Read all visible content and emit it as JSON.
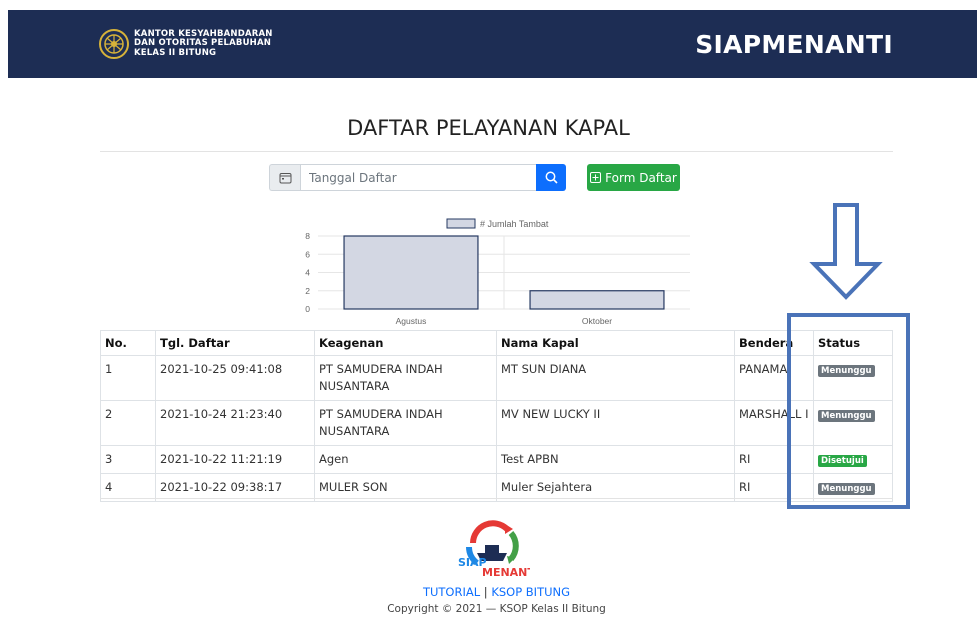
{
  "header": {
    "org_line1": "KANTOR KESYAHBANDARAN",
    "org_line2": "DAN OTORITAS PELABUHAN",
    "org_line3": "KELAS II BITUNG",
    "app_title": "SIAPMENANTI"
  },
  "page": {
    "title": "DAFTAR PELAYANAN KAPAL"
  },
  "search": {
    "placeholder": "Tanggal Daftar",
    "value": ""
  },
  "form_button": {
    "label": "Form Daftar"
  },
  "colors": {
    "navbar": "#1d2d54",
    "primary": "#0d6efd",
    "success": "#28a745",
    "secondary": "#6c757d",
    "bar_fill": "#d3d7e3",
    "bar_stroke": "#253861",
    "annotation": "#4a73b8"
  },
  "icons": [
    "calendar-icon",
    "search-icon",
    "plus-square-icon",
    "down-arrow-icon",
    "ship-logo"
  ],
  "chart_data": {
    "type": "bar",
    "categories": [
      "Agustus",
      "Oktober"
    ],
    "series": [
      {
        "name": "# Jumlah Tambat",
        "values": [
          8,
          2
        ]
      }
    ],
    "ylim": [
      0,
      8
    ],
    "yticks": [
      0,
      2,
      4,
      6,
      8
    ],
    "legend": "top",
    "grid": true
  },
  "table": {
    "columns": [
      "No.",
      "Tgl. Daftar",
      "Keagenan",
      "Nama Kapal",
      "Bendera",
      "Status"
    ],
    "rows": [
      {
        "no": "1",
        "date": "2021-10-25 09:41:08",
        "agency": "PT SAMUDERA INDAH NUSANTARA",
        "ship": "MT SUN DIANA",
        "flag": "PANAMA",
        "status": "Menunggu"
      },
      {
        "no": "2",
        "date": "2021-10-24 21:23:40",
        "agency": "PT SAMUDERA INDAH NUSANTARA",
        "ship": "MV NEW LUCKY II",
        "flag": "MARSHALL I",
        "status": "Menunggu"
      },
      {
        "no": "3",
        "date": "2021-10-22 11:21:19",
        "agency": "Agen",
        "ship": "Test APBN",
        "flag": "RI",
        "status": "Disetujui"
      },
      {
        "no": "4",
        "date": "2021-10-22 09:38:17",
        "agency": "MULER SON",
        "ship": "Muler Sejahtera",
        "flag": "RI",
        "status": "Menunggu"
      }
    ]
  },
  "footer": {
    "link1": "TUTORIAL",
    "separator": "|",
    "link2": "KSOP BITUNG",
    "copyright": "Copyright © 2021 — KSOP Kelas II Bitung",
    "logo_text_1": "SIAP",
    "logo_text_2": "MENANTI"
  }
}
